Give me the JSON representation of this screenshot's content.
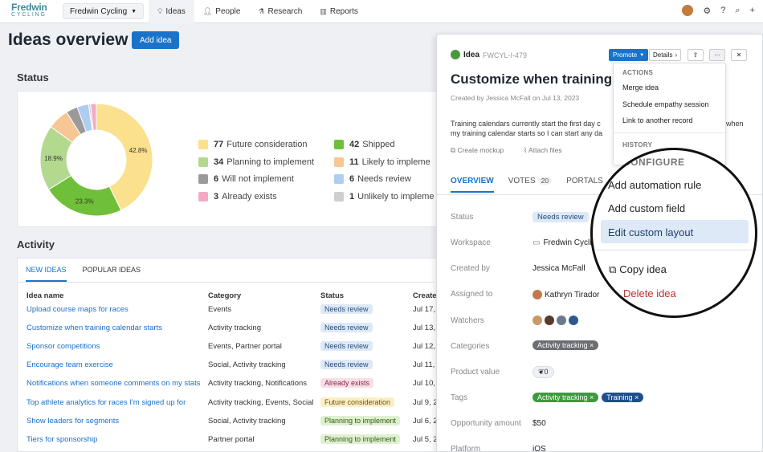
{
  "header": {
    "logo_line1": "Fredwin",
    "logo_line2": "CYCLING",
    "workspace": "Fredwin Cycling",
    "nav": [
      {
        "label": "Ideas",
        "icon": "lightbulb-icon"
      },
      {
        "label": "People",
        "icon": "person-icon"
      },
      {
        "label": "Research",
        "icon": "lab-flask-icon"
      },
      {
        "label": "Reports",
        "icon": "chart-icon"
      }
    ]
  },
  "page": {
    "title": "Ideas overview",
    "add_button": "Add idea",
    "status_title": "Status",
    "activity_title": "Activity"
  },
  "chart_data": {
    "type": "pie",
    "categories": [
      "Future consideration",
      "Planning to implement",
      "Will not implement",
      "Already exists",
      "Shipped",
      "Likely to implement",
      "Needs review",
      "Unlikely to implement"
    ],
    "values": [
      77,
      34,
      6,
      3,
      42,
      11,
      6,
      1
    ],
    "colors": [
      "#fbe08d",
      "#b2d98e",
      "#9a9a9a",
      "#f3aac5",
      "#6fbf3a",
      "#f7c695",
      "#aecdf0",
      "#cfcfcf"
    ],
    "slice_labels": [
      "42.8%",
      "18.9%",
      "23.3%"
    ],
    "legend": [
      {
        "count": "77",
        "label": "Future consideration",
        "color": "#fbe08d"
      },
      {
        "count": "34",
        "label": "Planning to implement",
        "color": "#b2d98e"
      },
      {
        "count": "6",
        "label": "Will not implement",
        "color": "#9a9a9a"
      },
      {
        "count": "3",
        "label": "Already exists",
        "color": "#f3aac5"
      },
      {
        "count": "42",
        "label": "Shipped",
        "color": "#6fbf3a"
      },
      {
        "count": "11",
        "label": "Likely to impleme",
        "color": "#f7c695"
      },
      {
        "count": "6",
        "label": "Needs review",
        "color": "#aecdf0"
      },
      {
        "count": "1",
        "label": "Unlikely to impleme",
        "color": "#cfcfcf"
      }
    ]
  },
  "activity": {
    "tabs": [
      "NEW IDEAS",
      "POPULAR IDEAS"
    ],
    "columns": [
      "Idea name",
      "Category",
      "Status",
      "Create"
    ],
    "rows": [
      {
        "name": "Upload course maps for races",
        "category": "Events",
        "status": "Needs review",
        "date": "Jul 17,"
      },
      {
        "name": "Customize when training calendar starts",
        "category": "Activity tracking",
        "status": "Needs review",
        "date": "Jul 13,"
      },
      {
        "name": "Sponsor competitions",
        "category": "Events, Partner portal",
        "status": "Needs review",
        "date": "Jul 12,"
      },
      {
        "name": "Encourage team exercise",
        "category": "Social, Activity tracking",
        "status": "Needs review",
        "date": "Jul 11,"
      },
      {
        "name": "Notifications when someone comments on my stats",
        "category": "Activity tracking, Notifications",
        "status": "Already exists",
        "date": "Jul 10,"
      },
      {
        "name": "Top athlete analytics for races I'm signed up for",
        "category": "Activity tracking, Events, Social",
        "status": "Future consideration",
        "date": "Jul 9, 2"
      },
      {
        "name": "Show leaders for segments",
        "category": "Social, Activity tracking",
        "status": "Planning to implement",
        "date": "Jul 6, 2"
      },
      {
        "name": "Tiers for sponsorship",
        "category": "Partner portal",
        "status": "Planning to implement",
        "date": "Jul 5, 2"
      }
    ],
    "status_colors": {
      "Needs review": {
        "bg": "#dde9f7",
        "fg": "#2a4d7a"
      },
      "Already exists": {
        "bg": "#fbdde8",
        "fg": "#7a2a48"
      },
      "Future consideration": {
        "bg": "#fcefc4",
        "fg": "#6d5514"
      },
      "Planning to implement": {
        "bg": "#dff0cf",
        "fg": "#355a1d"
      }
    }
  },
  "side": {
    "type": "Idea",
    "id": "FWCYL-I-479",
    "promote": "Promote",
    "details": "Details",
    "title": "Customize when training",
    "created": "Created by Jessica McFall on Jul 13, 2023",
    "desc_line1": "Training calendars currently start the first day c",
    "desc_line1_tail": "when",
    "desc_line2": "my training calendar starts so I can start any da",
    "create_mockup": "Create mockup",
    "attach_files": "Attach files",
    "tabs": [
      {
        "label": "OVERVIEW"
      },
      {
        "label": "VOTES",
        "count": "20"
      },
      {
        "label": "PORTALS"
      }
    ],
    "fields": [
      {
        "label": "Status",
        "value": "Needs review"
      },
      {
        "label": "Workspace",
        "value": "Fredwin Cycling"
      },
      {
        "label": "Created by",
        "value": "Jessica McFall"
      },
      {
        "label": "Assigned to",
        "value": "Kathryn Tirador"
      },
      {
        "label": "Watchers",
        "value": ""
      },
      {
        "label": "Categories",
        "value": "Activity tracking"
      },
      {
        "label": "Product value",
        "value": "0"
      },
      {
        "label": "Tags",
        "value": "Activity tracking",
        "value2": "Training"
      },
      {
        "label": "Opportunity amount",
        "value": "$50"
      },
      {
        "label": "Platform",
        "value": "iOS"
      }
    ]
  },
  "menu": {
    "actions_header": "ACTIONS",
    "actions": [
      "Merge idea",
      "Schedule empathy session",
      "Link to another record"
    ],
    "history_header": "HISTORY",
    "configure_header": "CONFIGURE",
    "configure_items": [
      "Add automation rule",
      "Add custom field",
      "Edit custom layout"
    ],
    "copy": "Copy idea",
    "delete": "Delete idea"
  }
}
